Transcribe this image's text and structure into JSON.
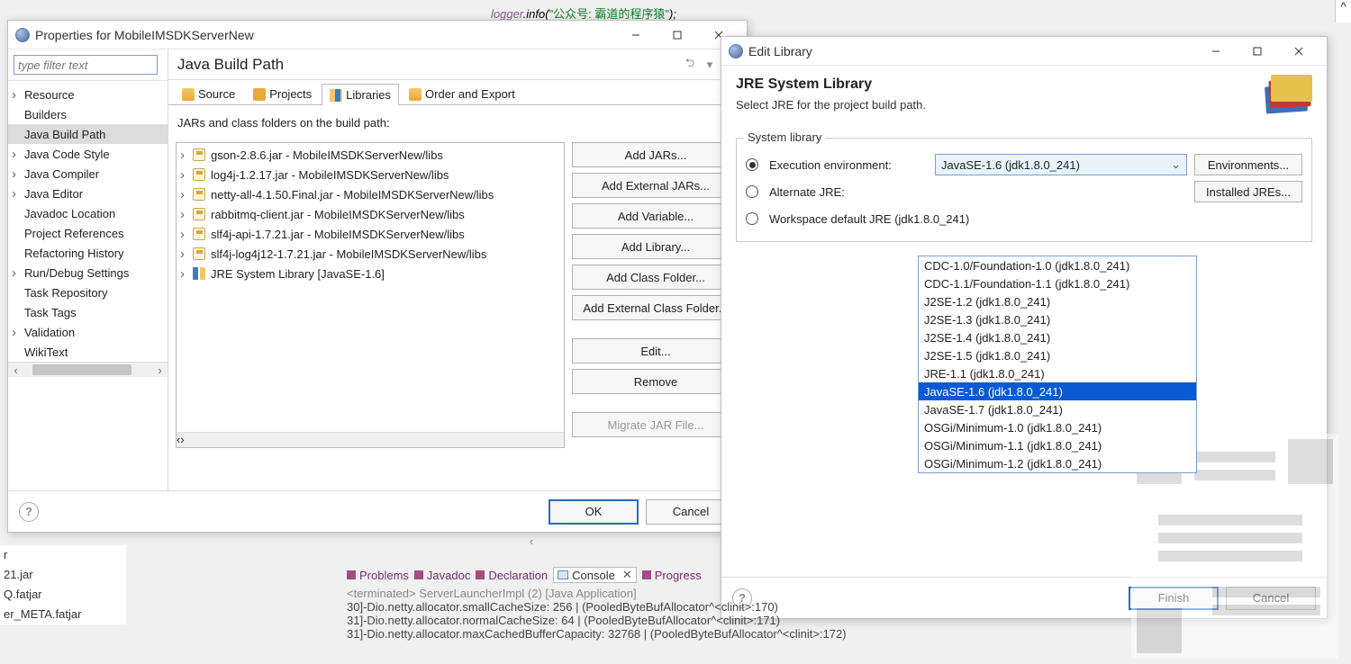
{
  "bg_code": {
    "obj": "logger",
    "method": ".info(",
    "str": "\"公众号: 霸道的程序猿\"",
    "end": ");"
  },
  "props_window": {
    "title": "Properties for MobileIMSDKServerNew",
    "filter_placeholder": "type filter text",
    "nav": [
      "Resource",
      "Builders",
      "Java Build Path",
      "Java Code Style",
      "Java Compiler",
      "Java Editor",
      "Javadoc Location",
      "Project References",
      "Refactoring History",
      "Run/Debug Settings",
      "Task Repository",
      "Task Tags",
      "Validation",
      "WikiText"
    ],
    "header": "Java Build Path",
    "tabs": [
      "Source",
      "Projects",
      "Libraries",
      "Order and Export"
    ],
    "list_label": "JARs and class folders on the build path:",
    "jars": [
      "gson-2.8.6.jar - MobileIMSDKServerNew/libs",
      "log4j-1.2.17.jar - MobileIMSDKServerNew/libs",
      "netty-all-4.1.50.Final.jar - MobileIMSDKServerNew/libs",
      "rabbitmq-client.jar - MobileIMSDKServerNew/libs",
      "slf4j-api-1.7.21.jar - MobileIMSDKServerNew/libs",
      "slf4j-log4j12-1.7.21.jar - MobileIMSDKServerNew/libs"
    ],
    "jre_item": "JRE System Library [JavaSE-1.6]",
    "buttons": [
      "Add JARs...",
      "Add External JARs...",
      "Add Variable...",
      "Add Library...",
      "Add Class Folder...",
      "Add External Class Folder...",
      "Edit...",
      "Remove",
      "Migrate JAR File..."
    ],
    "ok": "OK",
    "cancel": "Cancel"
  },
  "lib_window": {
    "title": "Edit Library",
    "heading": "JRE System Library",
    "sub": "Select JRE for the project build path.",
    "group": "System library",
    "r1": "Execution environment:",
    "r2": "Alternate JRE:",
    "r3": "Workspace default JRE (jdk1.8.0_241)",
    "combo_value": "JavaSE-1.6 (jdk1.8.0_241)",
    "env_btn": "Environments...",
    "installed_btn": "Installed JREs...",
    "dropdown": [
      "CDC-1.0/Foundation-1.0 (jdk1.8.0_241)",
      "CDC-1.1/Foundation-1.1 (jdk1.8.0_241)",
      "J2SE-1.2 (jdk1.8.0_241)",
      "J2SE-1.3 (jdk1.8.0_241)",
      "J2SE-1.4 (jdk1.8.0_241)",
      "J2SE-1.5 (jdk1.8.0_241)",
      "JRE-1.1 (jdk1.8.0_241)",
      "JavaSE-1.6 (jdk1.8.0_241)",
      "JavaSE-1.7 (jdk1.8.0_241)",
      "OSGi/Minimum-1.0 (jdk1.8.0_241)",
      "OSGi/Minimum-1.1 (jdk1.8.0_241)",
      "OSGi/Minimum-1.2 (jdk1.8.0_241)"
    ],
    "finish": "Finish",
    "cancel": "Cancel"
  },
  "console_tabs": {
    "problems": "Problems",
    "javadoc": "Javadoc",
    "declaration": "Declaration",
    "console": "Console",
    "progress": "Progress"
  },
  "console": {
    "term": "<terminated> ServerLauncherImpl (2) [Java Application]",
    "l1": "30]-Dio.netty.allocator.smallCacheSize: 256 | (PooledByteBufAllocator^<clinit>:170)",
    "l2": "31]-Dio.netty.allocator.normalCacheSize: 64 | (PooledByteBufAllocator^<clinit>:171)",
    "l3": "31]-Dio.netty.allocator.maxCachedBufferCapacity: 32768 | (PooledByteBufAllocator^<clinit>:172)"
  },
  "left_frag": {
    "a": "21.jar",
    "b": "Q.fatjar",
    "c": "er_META.fatjar"
  }
}
